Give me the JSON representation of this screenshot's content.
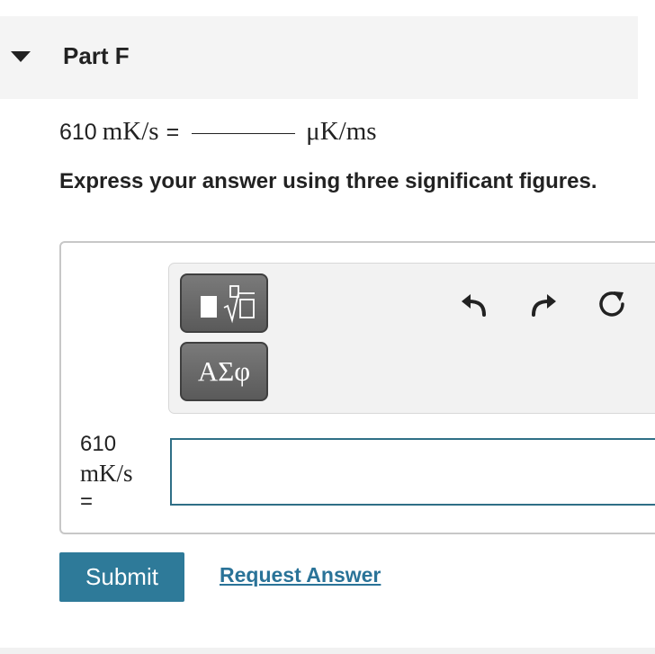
{
  "part": {
    "title": "Part F",
    "collapse_icon": "caret-down-icon"
  },
  "question": {
    "value": "610",
    "from_unit": "mK/s",
    "equals": "=",
    "to_unit": "μK/ms"
  },
  "instruction": "Express your answer using three significant figures.",
  "toolbar": {
    "templates_icon": "templates-icon",
    "symbols_label": "ΑΣφ",
    "undo_icon": "undo-icon",
    "redo_icon": "redo-icon",
    "reset_icon": "reset-icon"
  },
  "answer": {
    "label_value": "610",
    "label_unit": "mK/s",
    "label_equals": "=",
    "input_value": ""
  },
  "actions": {
    "submit_label": "Submit",
    "request_answer_label": "Request Answer"
  },
  "colors": {
    "accent": "#2e7a99",
    "link": "#2a7398",
    "input_border": "#2f6f86",
    "header_bg": "#f4f4f4"
  }
}
